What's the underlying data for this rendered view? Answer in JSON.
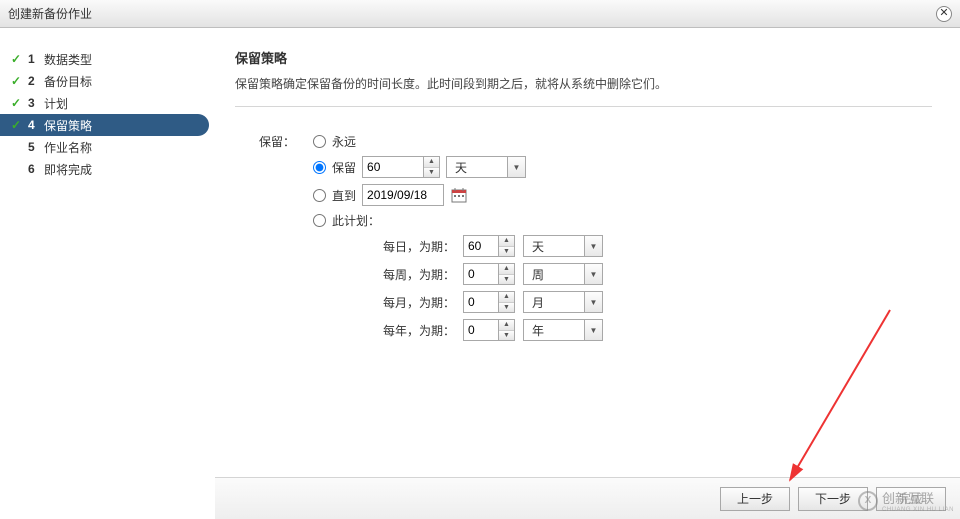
{
  "window": {
    "title": "创建新备份作业"
  },
  "steps": [
    {
      "num": "1",
      "label": "数据类型",
      "done": true
    },
    {
      "num": "2",
      "label": "备份目标",
      "done": true
    },
    {
      "num": "3",
      "label": "计划",
      "done": true
    },
    {
      "num": "4",
      "label": "保留策略",
      "done": true,
      "active": true
    },
    {
      "num": "5",
      "label": "作业名称",
      "done": false
    },
    {
      "num": "6",
      "label": "即将完成",
      "done": false
    }
  ],
  "content": {
    "heading": "保留策略",
    "desc": "保留策略确定保留备份的时间长度。此时间段到期之后，就将从系统中删除它们。"
  },
  "form": {
    "retain_label": "保留：",
    "options": {
      "forever": "永远",
      "keep": "保留",
      "until": "直到",
      "schedule": "此计划："
    },
    "selected": "keep",
    "keep_value": "60",
    "keep_unit": "天",
    "until_date": "2019/09/18",
    "sched": {
      "daily_label": "每日，为期：",
      "daily_value": "60",
      "daily_unit": "天",
      "weekly_label": "每周，为期：",
      "weekly_value": "0",
      "weekly_unit": "周",
      "monthly_label": "每月，为期：",
      "monthly_value": "0",
      "monthly_unit": "月",
      "yearly_label": "每年，为期：",
      "yearly_value": "0",
      "yearly_unit": "年"
    }
  },
  "buttons": {
    "prev": "上一步",
    "next": "下一步",
    "finish": "完成"
  },
  "watermark": {
    "brand": "创新互联",
    "sub": "CHUANG XIN HU LIAN"
  }
}
